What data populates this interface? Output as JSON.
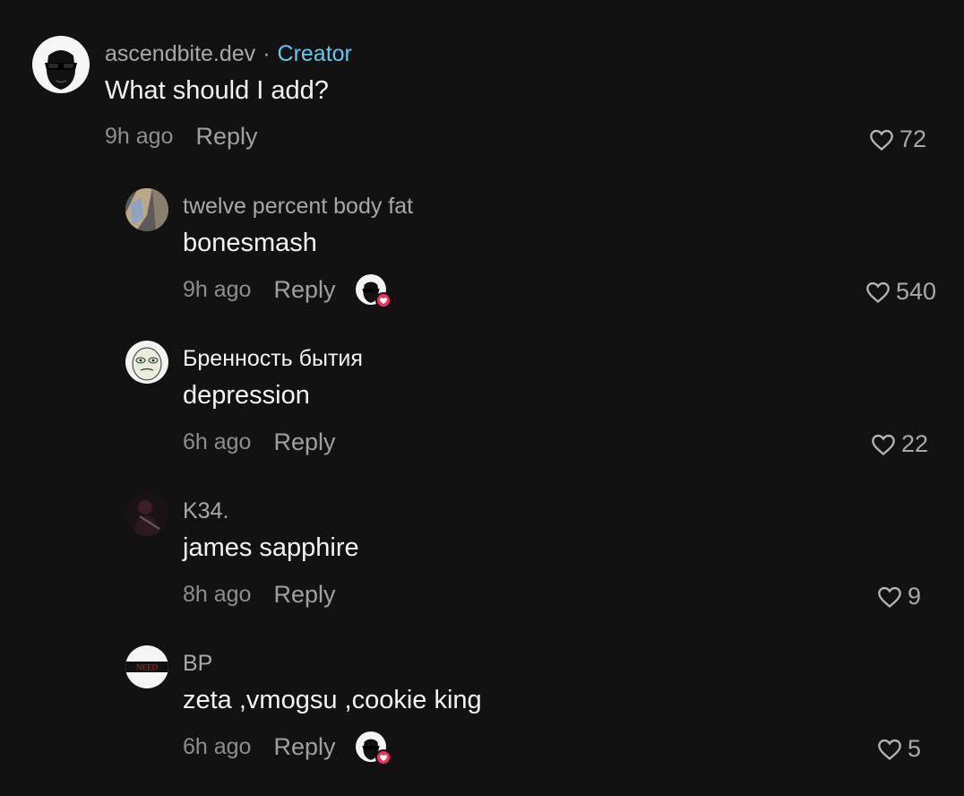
{
  "comments": [
    {
      "username": "ascendbite.dev",
      "separator": "·",
      "badge": "Creator",
      "text": "What should I add?",
      "time": "9h ago",
      "reply_label": "Reply",
      "likes": "72",
      "avatar_icon": "masked-face-avatar"
    },
    {
      "username": "twelve percent body fat",
      "text": "bonesmash",
      "time": "9h ago",
      "reply_label": "Reply",
      "likes": "540",
      "liked_by_creator": true,
      "avatar_icon": "photo-avatar"
    },
    {
      "username": "Бренность бытия",
      "text": "depression",
      "time": "6h ago",
      "reply_label": "Reply",
      "likes": "22",
      "avatar_icon": "meme-face-avatar"
    },
    {
      "username": "K34.",
      "text": "james sapphire",
      "time": "8h ago",
      "reply_label": "Reply",
      "likes": "9",
      "avatar_icon": "dark-photo-avatar"
    },
    {
      "username": "BP",
      "text": "zeta ,vmogsu ,cookie king",
      "time": "6h ago",
      "reply_label": "Reply",
      "likes": "5",
      "liked_by_creator": true,
      "avatar_icon": "need-text-avatar",
      "avatar_text": "NEED"
    }
  ],
  "colors": {
    "background": "#121212",
    "creator_badge": "#5ecbf3",
    "heart_badge": "#fe2c55"
  }
}
